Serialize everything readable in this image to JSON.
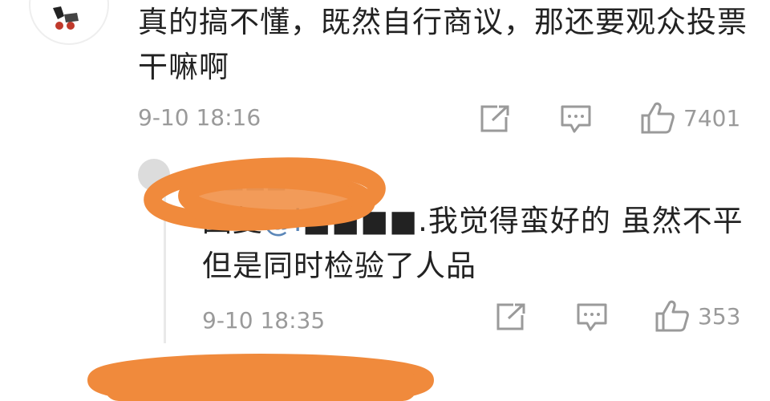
{
  "comment": {
    "text": "真的搞不懂，既然自行商议，那还要观众投票干嘛啊",
    "time": "9-10 18:16",
    "like_count": "7401",
    "icons": {
      "share": "share-icon",
      "comment": "comment-icon",
      "like": "thumbs-up-icon"
    }
  },
  "reply": {
    "prefix": "回复",
    "mention": "@l",
    "text": "我觉得蛮好的 虽然不平 但是同时检验了人品",
    "time": "9-10 18:35",
    "like_count": "353"
  },
  "colors": {
    "text": "#222222",
    "meta": "#9a9a9a",
    "mention": "#5a86b8",
    "redaction": "#f08a3c"
  }
}
